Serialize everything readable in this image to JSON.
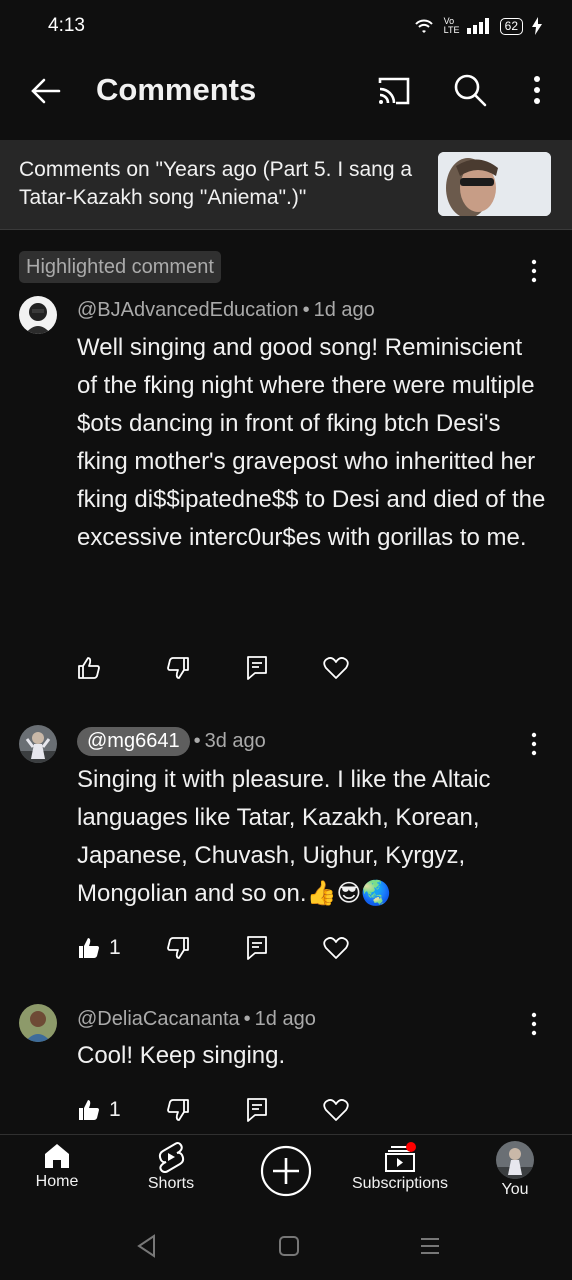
{
  "status": {
    "time": "4:13",
    "battery": "62",
    "network_label": "Vo LTE"
  },
  "app_bar": {
    "title": "Comments"
  },
  "video": {
    "header": "Comments on \"Years ago (Part 5. I sang a Tatar-Kazakh song \"Aniema\".)\""
  },
  "highlighted_label": "Highlighted comment",
  "comments": [
    {
      "author": "@BJAdvancedEducation",
      "time": "1d ago",
      "text": "Well singing and good song! Reminiscient of the fking night where there were multiple $ots dancing in front of fking btch Desi's fking mother's gravepost who inheritted her fking di$$ipatedne$$ to Desi and died of the excessive interc0ur$es with gorillas to me.",
      "likes": ""
    },
    {
      "author": "@mg6641",
      "time": "3d ago",
      "text": "Singing it with pleasure. I like the Altaic languages like Tatar, Kazakh, Korean, Japanese, Chuvash, Uighur, Kyrgyz, Mongolian and so on.👍😎🌏",
      "likes": "1"
    },
    {
      "author": "@DeliaCacananta",
      "time": "1d ago",
      "text": "Cool! Keep singing.",
      "likes": "1"
    }
  ],
  "bottom_nav": {
    "home": "Home",
    "shorts": "Shorts",
    "subscriptions": "Subscriptions",
    "you": "You"
  },
  "colors": {
    "background": "#0f0f0f",
    "header_bg": "#272727",
    "secondary_text": "#aaaaaa",
    "badge_red": "#ff0000"
  },
  "icons": [
    "back-arrow-icon",
    "cast-icon",
    "search-icon",
    "more-vert-icon",
    "thumb-up-icon",
    "thumb-down-icon",
    "reply-icon",
    "heart-icon",
    "home-icon",
    "shorts-icon",
    "create-icon",
    "subscriptions-icon"
  ]
}
